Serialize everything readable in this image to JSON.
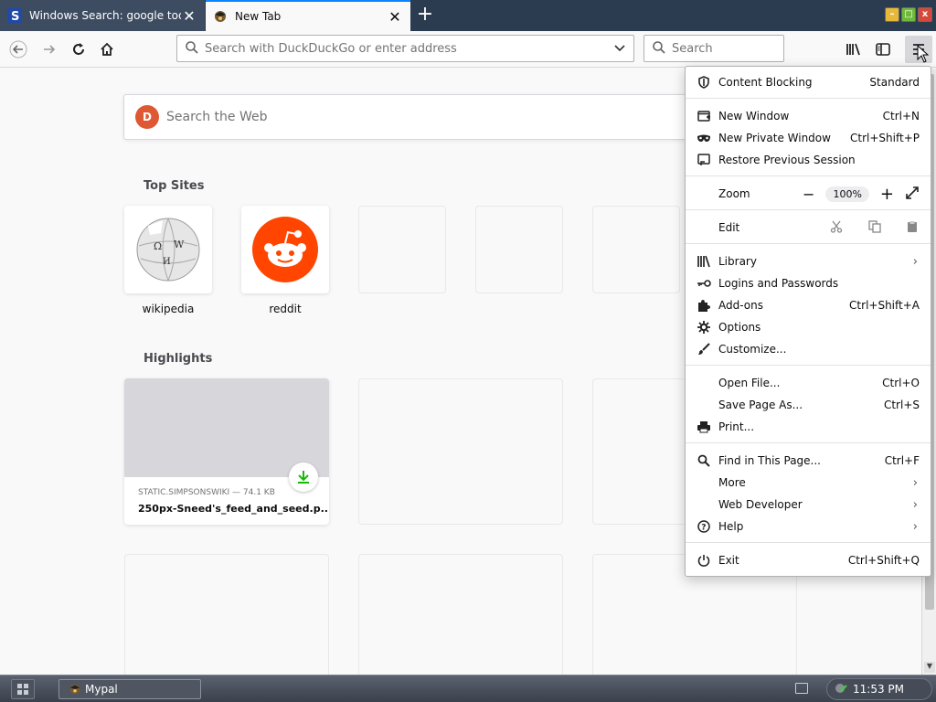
{
  "tabs": [
    {
      "title": "Windows Search: google too",
      "active": false
    },
    {
      "title": "New Tab",
      "active": true
    }
  ],
  "window_controls": {
    "minimize": "–",
    "maximize": "□",
    "close": "x"
  },
  "toolbar": {
    "url_placeholder": "Search with DuckDuckGo or enter address",
    "search_placeholder": "Search"
  },
  "newtab": {
    "web_search_placeholder": "Search the Web",
    "top_sites_heading": "Top Sites",
    "top_sites": [
      {
        "label": "wikipedia",
        "icon": "wikipedia-icon"
      },
      {
        "label": "reddit",
        "icon": "reddit-icon"
      }
    ],
    "highlights_heading": "Highlights",
    "highlights": [
      {
        "source": "STATIC.SIMPSONSWIKI — 74.1 KB",
        "title": "250px-Sneed's_feed_and_seed.p..."
      }
    ]
  },
  "menu": {
    "content_blocking": {
      "label": "Content Blocking",
      "value": "Standard"
    },
    "new_window": {
      "label": "New Window",
      "shortcut": "Ctrl+N"
    },
    "new_private_window": {
      "label": "New Private Window",
      "shortcut": "Ctrl+Shift+P"
    },
    "restore_session": {
      "label": "Restore Previous Session"
    },
    "zoom": {
      "label": "Zoom",
      "value": "100%",
      "minus": "−",
      "plus": "+"
    },
    "edit": {
      "label": "Edit"
    },
    "library": {
      "label": "Library"
    },
    "logins": {
      "label": "Logins and Passwords"
    },
    "addons": {
      "label": "Add-ons",
      "shortcut": "Ctrl+Shift+A"
    },
    "options": {
      "label": "Options"
    },
    "customize": {
      "label": "Customize..."
    },
    "open_file": {
      "label": "Open File...",
      "shortcut": "Ctrl+O"
    },
    "save_page": {
      "label": "Save Page As...",
      "shortcut": "Ctrl+S"
    },
    "print": {
      "label": "Print..."
    },
    "find": {
      "label": "Find in This Page...",
      "shortcut": "Ctrl+F"
    },
    "more": {
      "label": "More"
    },
    "web_developer": {
      "label": "Web Developer"
    },
    "help": {
      "label": "Help"
    },
    "exit": {
      "label": "Exit",
      "shortcut": "Ctrl+Shift+Q"
    },
    "submenu_arrow": "›"
  },
  "taskbar": {
    "task_label": "Mypal",
    "clock": "11:53 PM"
  },
  "colors": {
    "accent": "#0a84ff",
    "tabstrip": "#2b3b50",
    "duckduckgo": "#de5833",
    "reddit": "#ff4500",
    "download_green": "#12bc00"
  }
}
